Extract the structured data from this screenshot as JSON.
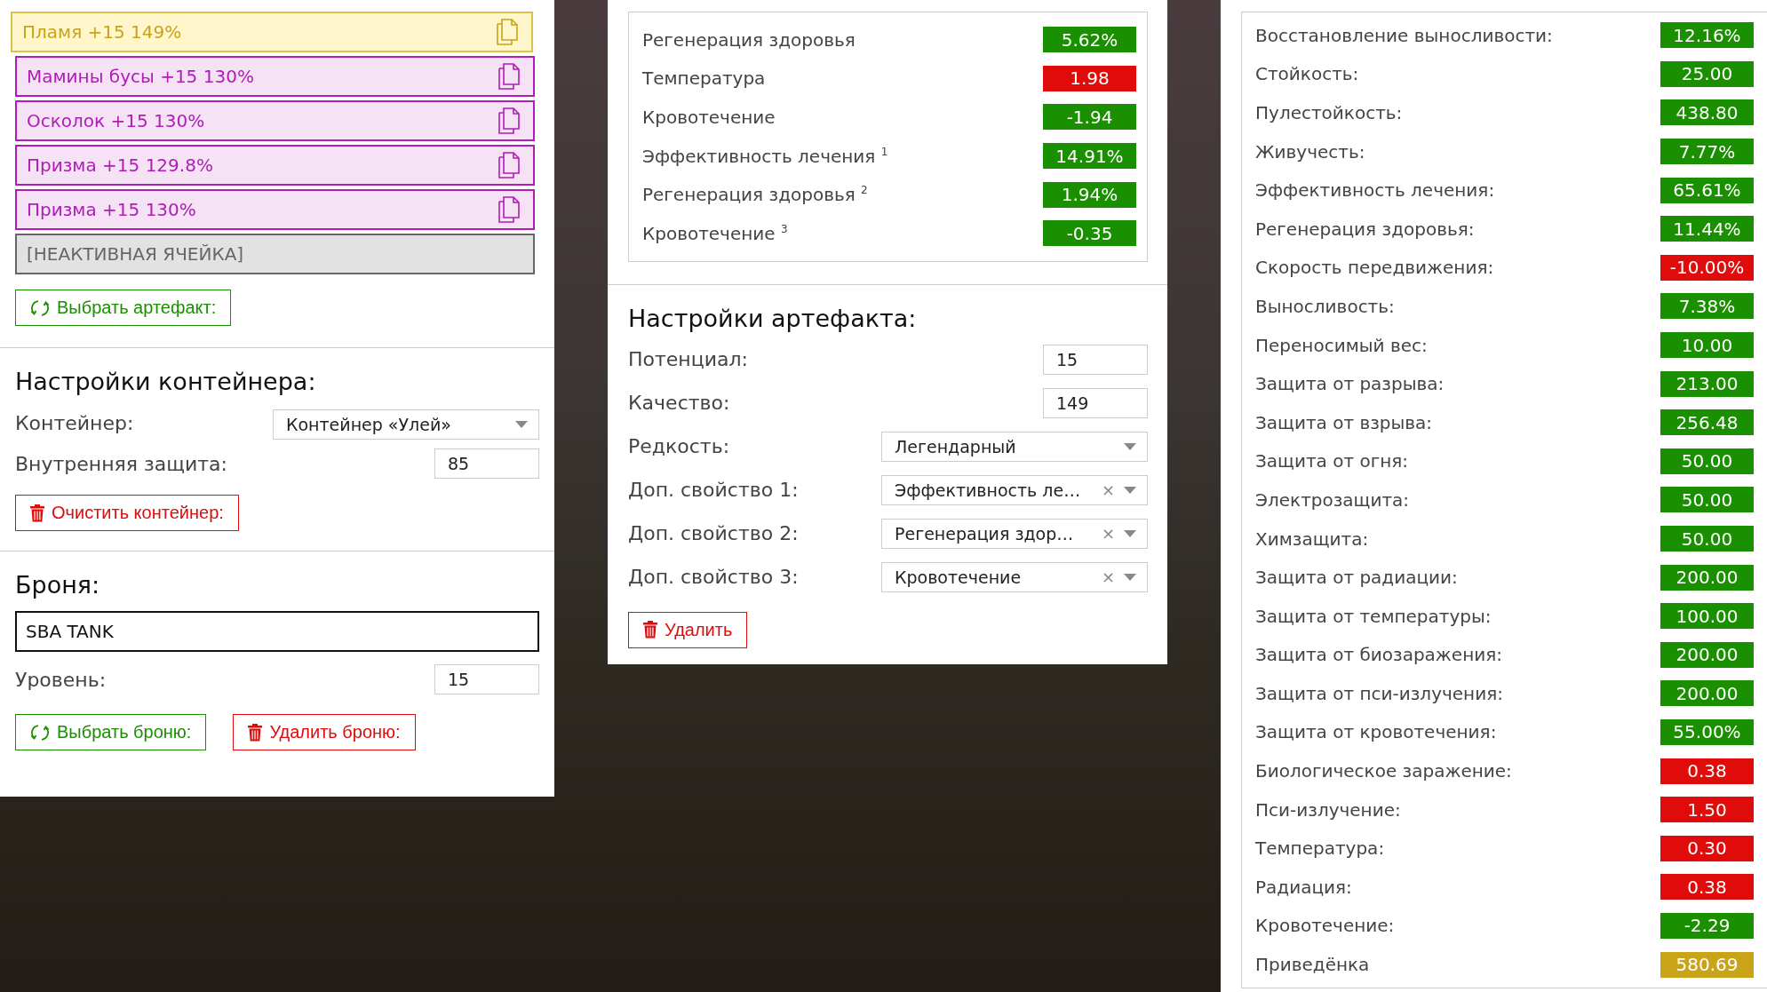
{
  "artifacts": [
    {
      "name": "Пламя +15 149%",
      "kind": "legendary"
    },
    {
      "name": "Мамины бусы +15 130%",
      "kind": "epic"
    },
    {
      "name": "Осколок +15 130%",
      "kind": "epic"
    },
    {
      "name": "Призма +15 129.8%",
      "kind": "epic"
    },
    {
      "name": "Призма +15 130%",
      "kind": "epic"
    },
    {
      "name": "[НЕАКТИВНАЯ ЯЧЕЙКА]",
      "kind": "inactive"
    }
  ],
  "select_artifact_button": "Выбрать артефакт:",
  "container_settings": {
    "title": "Настройки контейнера:",
    "container_label": "Контейнер:",
    "container_value": "Контейнер «Улей»",
    "protection_label": "Внутренняя защита:",
    "protection_value": "85",
    "clear_button": "Очистить контейнер:"
  },
  "armor": {
    "title": "Броня:",
    "name_value": "SBA TANK",
    "level_label": "Уровень:",
    "level_value": "15",
    "select_button": "Выбрать броню:",
    "delete_button": "Удалить броню:"
  },
  "artifact_stats": [
    {
      "label": "Регенерация здоровья",
      "value": "5.62%",
      "kind": "positive"
    },
    {
      "label": "Температура",
      "value": "1.98",
      "kind": "negative"
    },
    {
      "label": "Кровотечение",
      "value": "-1.94",
      "kind": "positive"
    },
    {
      "label": "Эффективность лечения $^{1}$",
      "value": "14.91%",
      "kind": "positive"
    },
    {
      "label": "Регенерация здоровья $^{2}$",
      "value": "1.94%",
      "kind": "positive"
    },
    {
      "label": "Кровотечение $^{3}$",
      "value": "-0.35",
      "kind": "positive"
    }
  ],
  "artifact_settings": {
    "title": "Настройки артефакта:",
    "fields": [
      {
        "label": "Потенциал:",
        "value": "15",
        "kind": "input"
      },
      {
        "label": "Качество:",
        "value": "149",
        "kind": "input"
      },
      {
        "label": "Редкость:",
        "value": "Легендарный",
        "kind": "select"
      },
      {
        "label": "Доп. свойство 1:",
        "value": "Эффективность ле…",
        "kind": "select",
        "clear": "×"
      },
      {
        "label": "Доп. свойство 2:",
        "value": "Регенерация здор…",
        "kind": "select",
        "clear": "×"
      },
      {
        "label": "Доп. свойство 3:",
        "value": "Кровотечение",
        "kind": "select",
        "clear": "×"
      }
    ],
    "delete_button": "Удалить"
  },
  "totals": [
    {
      "label": "Восстановление выносливости:",
      "value": "12.16%",
      "kind": "positive"
    },
    {
      "label": "Стойкость:",
      "value": "25.00",
      "kind": "positive"
    },
    {
      "label": "Пулестойкость:",
      "value": "438.80",
      "kind": "positive"
    },
    {
      "label": "Живучесть:",
      "value": "7.77%",
      "kind": "positive"
    },
    {
      "label": "Эффективность лечения:",
      "value": "65.61%",
      "kind": "positive"
    },
    {
      "label": "Регенерация здоровья:",
      "value": "11.44%",
      "kind": "positive"
    },
    {
      "label": "Скорость передвижения:",
      "value": "-10.00%",
      "kind": "negative"
    },
    {
      "label": "Выносливость:",
      "value": "7.38%",
      "kind": "positive"
    },
    {
      "label": "Переносимый вес:",
      "value": "10.00",
      "kind": "positive"
    },
    {
      "label": "Защита от разрыва:",
      "value": "213.00",
      "kind": "positive"
    },
    {
      "label": "Защита от взрыва:",
      "value": "256.48",
      "kind": "positive"
    },
    {
      "label": "Защита от огня:",
      "value": "50.00",
      "kind": "positive"
    },
    {
      "label": "Электрозащита:",
      "value": "50.00",
      "kind": "positive"
    },
    {
      "label": "Химзащита:",
      "value": "50.00",
      "kind": "positive"
    },
    {
      "label": "Защита от радиации:",
      "value": "200.00",
      "kind": "positive"
    },
    {
      "label": "Защита от температуры:",
      "value": "100.00",
      "kind": "positive"
    },
    {
      "label": "Защита от биозаражения:",
      "value": "200.00",
      "kind": "positive"
    },
    {
      "label": "Защита от пси-излучения:",
      "value": "200.00",
      "kind": "positive"
    },
    {
      "label": "Защита от кровотечения:",
      "value": "55.00%",
      "kind": "positive"
    },
    {
      "label": "Биологическое заражение:",
      "value": "0.38",
      "kind": "negative"
    },
    {
      "label": "Пси-излучение:",
      "value": "1.50",
      "kind": "negative"
    },
    {
      "label": "Температура:",
      "value": "0.30",
      "kind": "negative"
    },
    {
      "label": "Радиация:",
      "value": "0.38",
      "kind": "negative"
    },
    {
      "label": "Кровотечение:",
      "value": "-2.29",
      "kind": "positive"
    },
    {
      "label": "Приведёнка",
      "value": "580.69",
      "kind": "total"
    }
  ]
}
